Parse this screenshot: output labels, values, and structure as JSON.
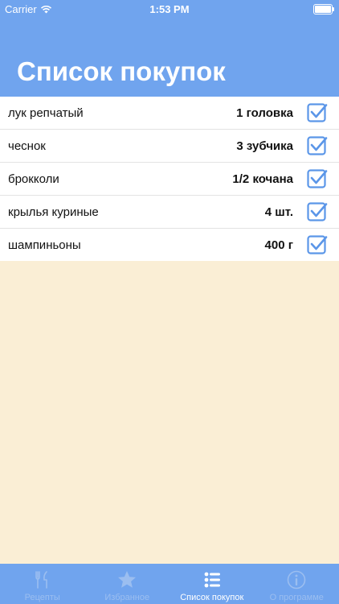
{
  "status_bar": {
    "carrier": "Carrier",
    "time": "1:53 PM"
  },
  "header": {
    "title": "Список покупок"
  },
  "shopping_list": [
    {
      "name": "лук репчатый",
      "quantity": "1 головка",
      "checked": true
    },
    {
      "name": "чеснок",
      "quantity": "3 зубчика",
      "checked": true
    },
    {
      "name": "брокколи",
      "quantity": "1/2 кочана",
      "checked": true
    },
    {
      "name": "крылья куриные",
      "quantity": "4 шт.",
      "checked": true
    },
    {
      "name": "шампиньоны",
      "quantity": "400 г",
      "checked": true
    }
  ],
  "tabbar": {
    "recipes": {
      "label": "Рецепты",
      "icon": "fork-knife-icon"
    },
    "favorites": {
      "label": "Избранное",
      "icon": "star-icon"
    },
    "shopping": {
      "label": "Список покупок",
      "icon": "list-icon",
      "active": true
    },
    "about": {
      "label": "О программе",
      "icon": "info-icon"
    }
  },
  "colors": {
    "header": "#70a4ee",
    "background": "#faeed5",
    "check": "#5b96e8"
  }
}
